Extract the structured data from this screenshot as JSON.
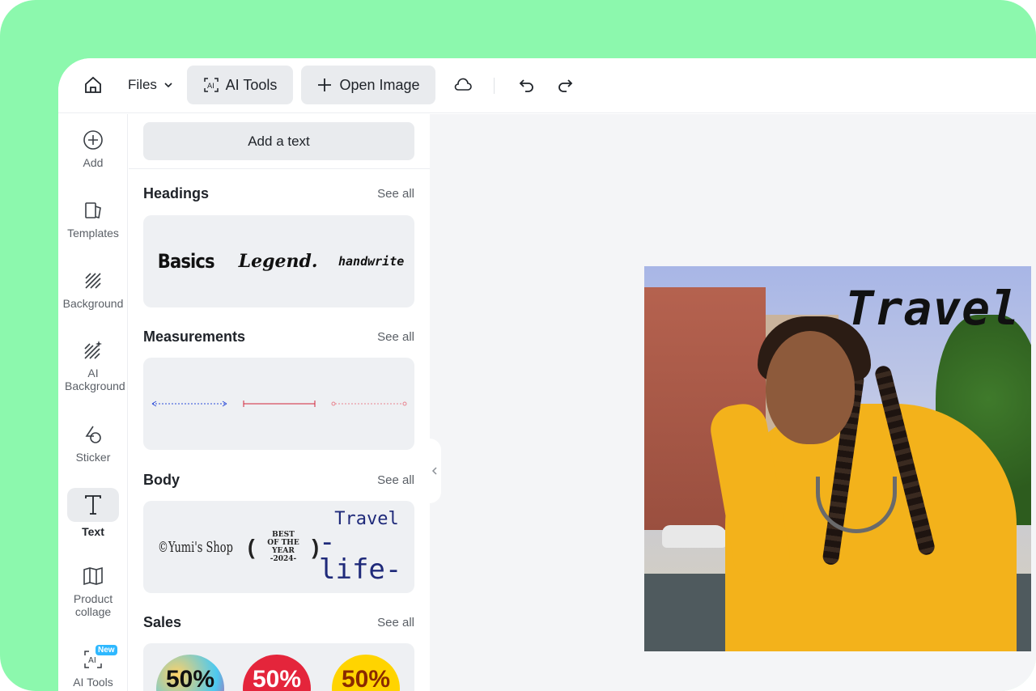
{
  "topbar": {
    "files_label": "Files",
    "ai_tools_label": "AI Tools",
    "open_image_label": "Open Image"
  },
  "rail": {
    "items": [
      {
        "label": "Add",
        "icon": "plus-circle-icon"
      },
      {
        "label": "Templates",
        "icon": "templates-icon"
      },
      {
        "label": "Background",
        "icon": "background-hatch-icon"
      },
      {
        "label": "AI Background",
        "icon": "ai-background-icon"
      },
      {
        "label": "Sticker",
        "icon": "sticker-icon"
      },
      {
        "label": "Text",
        "icon": "text-icon",
        "active": true
      },
      {
        "label": "Product collage",
        "icon": "collage-icon"
      },
      {
        "label": "AI Tools",
        "icon": "ai-tools-icon",
        "badge": "New"
      }
    ]
  },
  "panel": {
    "add_text_label": "Add a text",
    "sections": {
      "headings": {
        "title": "Headings",
        "see_all": "See all",
        "samples": [
          "Basics",
          "Legend.",
          "handwrite"
        ]
      },
      "measurements": {
        "title": "Measurements",
        "see_all": "See all"
      },
      "body": {
        "title": "Body",
        "see_all": "See all",
        "shop": "©Yumi's Shop",
        "best_1": "BEST",
        "best_2": "OF THE YEAR",
        "best_3": "-2024-",
        "travel_1": "Travel",
        "travel_2": "-life-"
      },
      "sales": {
        "title": "Sales",
        "see_all": "See all",
        "badges": [
          "50%",
          "50%",
          "50%"
        ]
      }
    }
  },
  "canvas": {
    "photo_title": "Travel"
  },
  "colors": {
    "frame_green": "#8cf8ad",
    "panel_gray": "#e9ebee",
    "sale_red": "#e4253b",
    "sale_yellow": "#ffd400"
  }
}
